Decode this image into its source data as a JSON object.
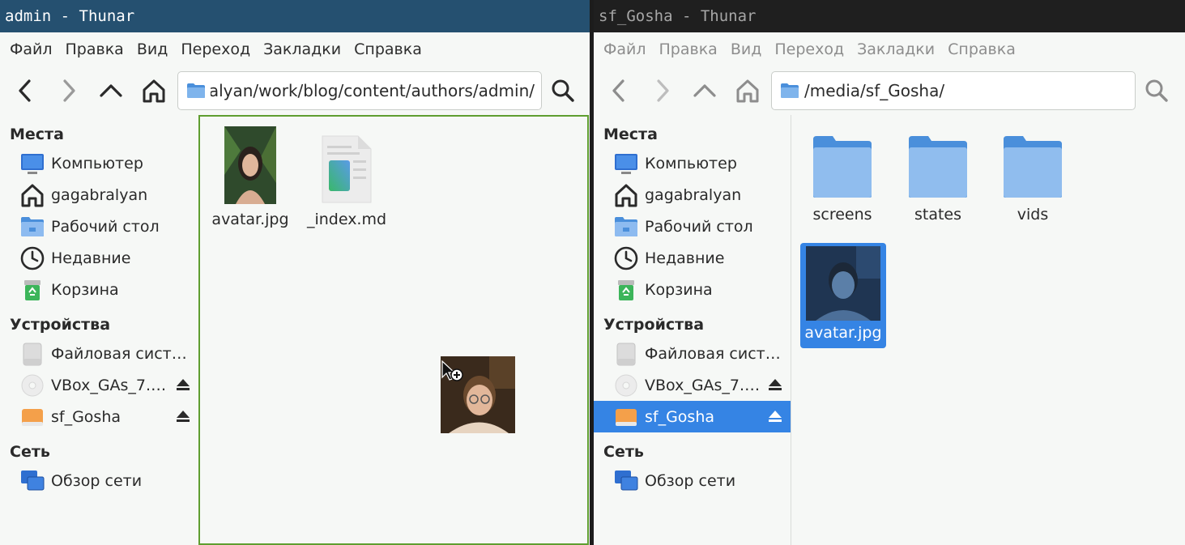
{
  "left": {
    "title": "admin - Thunar",
    "menu": [
      "Файл",
      "Правка",
      "Вид",
      "Переход",
      "Закладки",
      "Справка"
    ],
    "path": "/home/gagabralyan/work/blog/content/authors/admin/",
    "sidebar": {
      "places_title": "Места",
      "places": [
        "Компьютер",
        "gagabralyan",
        "Рабочий стол",
        "Недавние",
        "Корзина"
      ],
      "devices_title": "Устройства",
      "devices": [
        "Файловая сист…",
        "VBox_GAs_7.…",
        "sf_Gosha"
      ],
      "network_title": "Сеть",
      "network": [
        "Обзор сети"
      ]
    },
    "files": [
      "avatar.jpg",
      "_index.md"
    ]
  },
  "right": {
    "title": "sf_Gosha - Thunar",
    "menu": [
      "Файл",
      "Правка",
      "Вид",
      "Переход",
      "Закладки",
      "Справка"
    ],
    "path": "/media/sf_Gosha/",
    "sidebar": {
      "places_title": "Места",
      "places": [
        "Компьютер",
        "gagabralyan",
        "Рабочий стол",
        "Недавние",
        "Корзина"
      ],
      "devices_title": "Устройства",
      "devices": [
        "Файловая сист…",
        "VBox_GAs_7.…",
        "sf_Gosha"
      ],
      "network_title": "Сеть",
      "network": [
        "Обзор сети"
      ]
    },
    "files": [
      "screens",
      "states",
      "vids",
      "avatar.jpg"
    ]
  },
  "colors": {
    "active_titlebar": "#255070",
    "selection": "#3584e4",
    "drop_target_border": "#5f9e30",
    "folder": "#4a8fdb"
  }
}
